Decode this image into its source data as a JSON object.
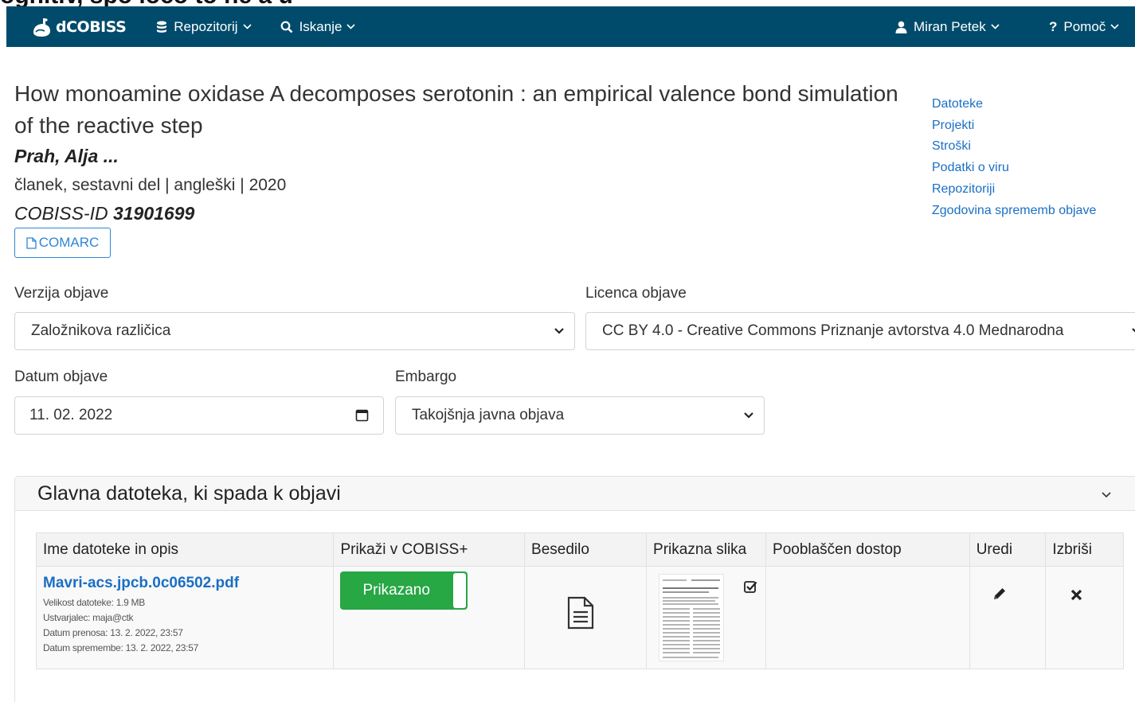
{
  "top_strip": {
    "text": "ognitiv, spo ločo to ne a u"
  },
  "navbar": {
    "brand": "dCOBISS",
    "repository": "Repozitorij",
    "search": "Iskanje",
    "user": "Miran Petek",
    "help": "Pomoč",
    "color": "#004b6b"
  },
  "record": {
    "title": "How monoamine oxidase A decomposes serotonin : an empirical valence bond simulation of the reactive step",
    "author": "Prah, Alja ...",
    "meta": "članek, sestavni del | angleški | 2020",
    "cobiss_label": "COBISS-ID",
    "cobiss_id": "31901699",
    "comarc_button": "COMARC"
  },
  "side_links": [
    "Datoteke",
    "Projekti",
    "Stroški",
    "Podatki o viru",
    "Repozitoriji",
    "Zgodovina sprememb objave"
  ],
  "form": {
    "version_label": "Verzija objave",
    "version_value": "Založnikova različica",
    "license_label": "Licenca objave",
    "license_value": "CC BY 4.0 - Creative Commons Priznanje avtorstva 4.0 Mednarodna",
    "date_label": "Datum objave",
    "date_value": "11. 02. 2022",
    "embargo_label": "Embargo",
    "embargo_value": "Takojšnja javna objava"
  },
  "files_section": {
    "title": "Glavna datoteka, ki spada k objavi",
    "columns": [
      "Ime datoteke in opis",
      "Prikaži v COBISS+",
      "Besedilo",
      "Prikazna slika",
      "Pooblaščen dostop",
      "Uredi",
      "Izbriši"
    ],
    "rows": [
      {
        "name": "Mavri-acs.jpcb.0c06502.pdf",
        "size": "Velikost datoteke: 1.9 MB",
        "creator": "Ustvarjalec: maja@ctk",
        "upload_date": "Datum prenosa: 13. 2. 2022, 23:57",
        "modified_date": "Datum spremembe: 13. 2. 2022, 23:57",
        "display_toggle": "Prikazano",
        "text_icon": "file-text-icon",
        "thumbnail_checked": true,
        "edit_icon": "pencil-icon",
        "delete_icon": "close-icon"
      }
    ]
  }
}
